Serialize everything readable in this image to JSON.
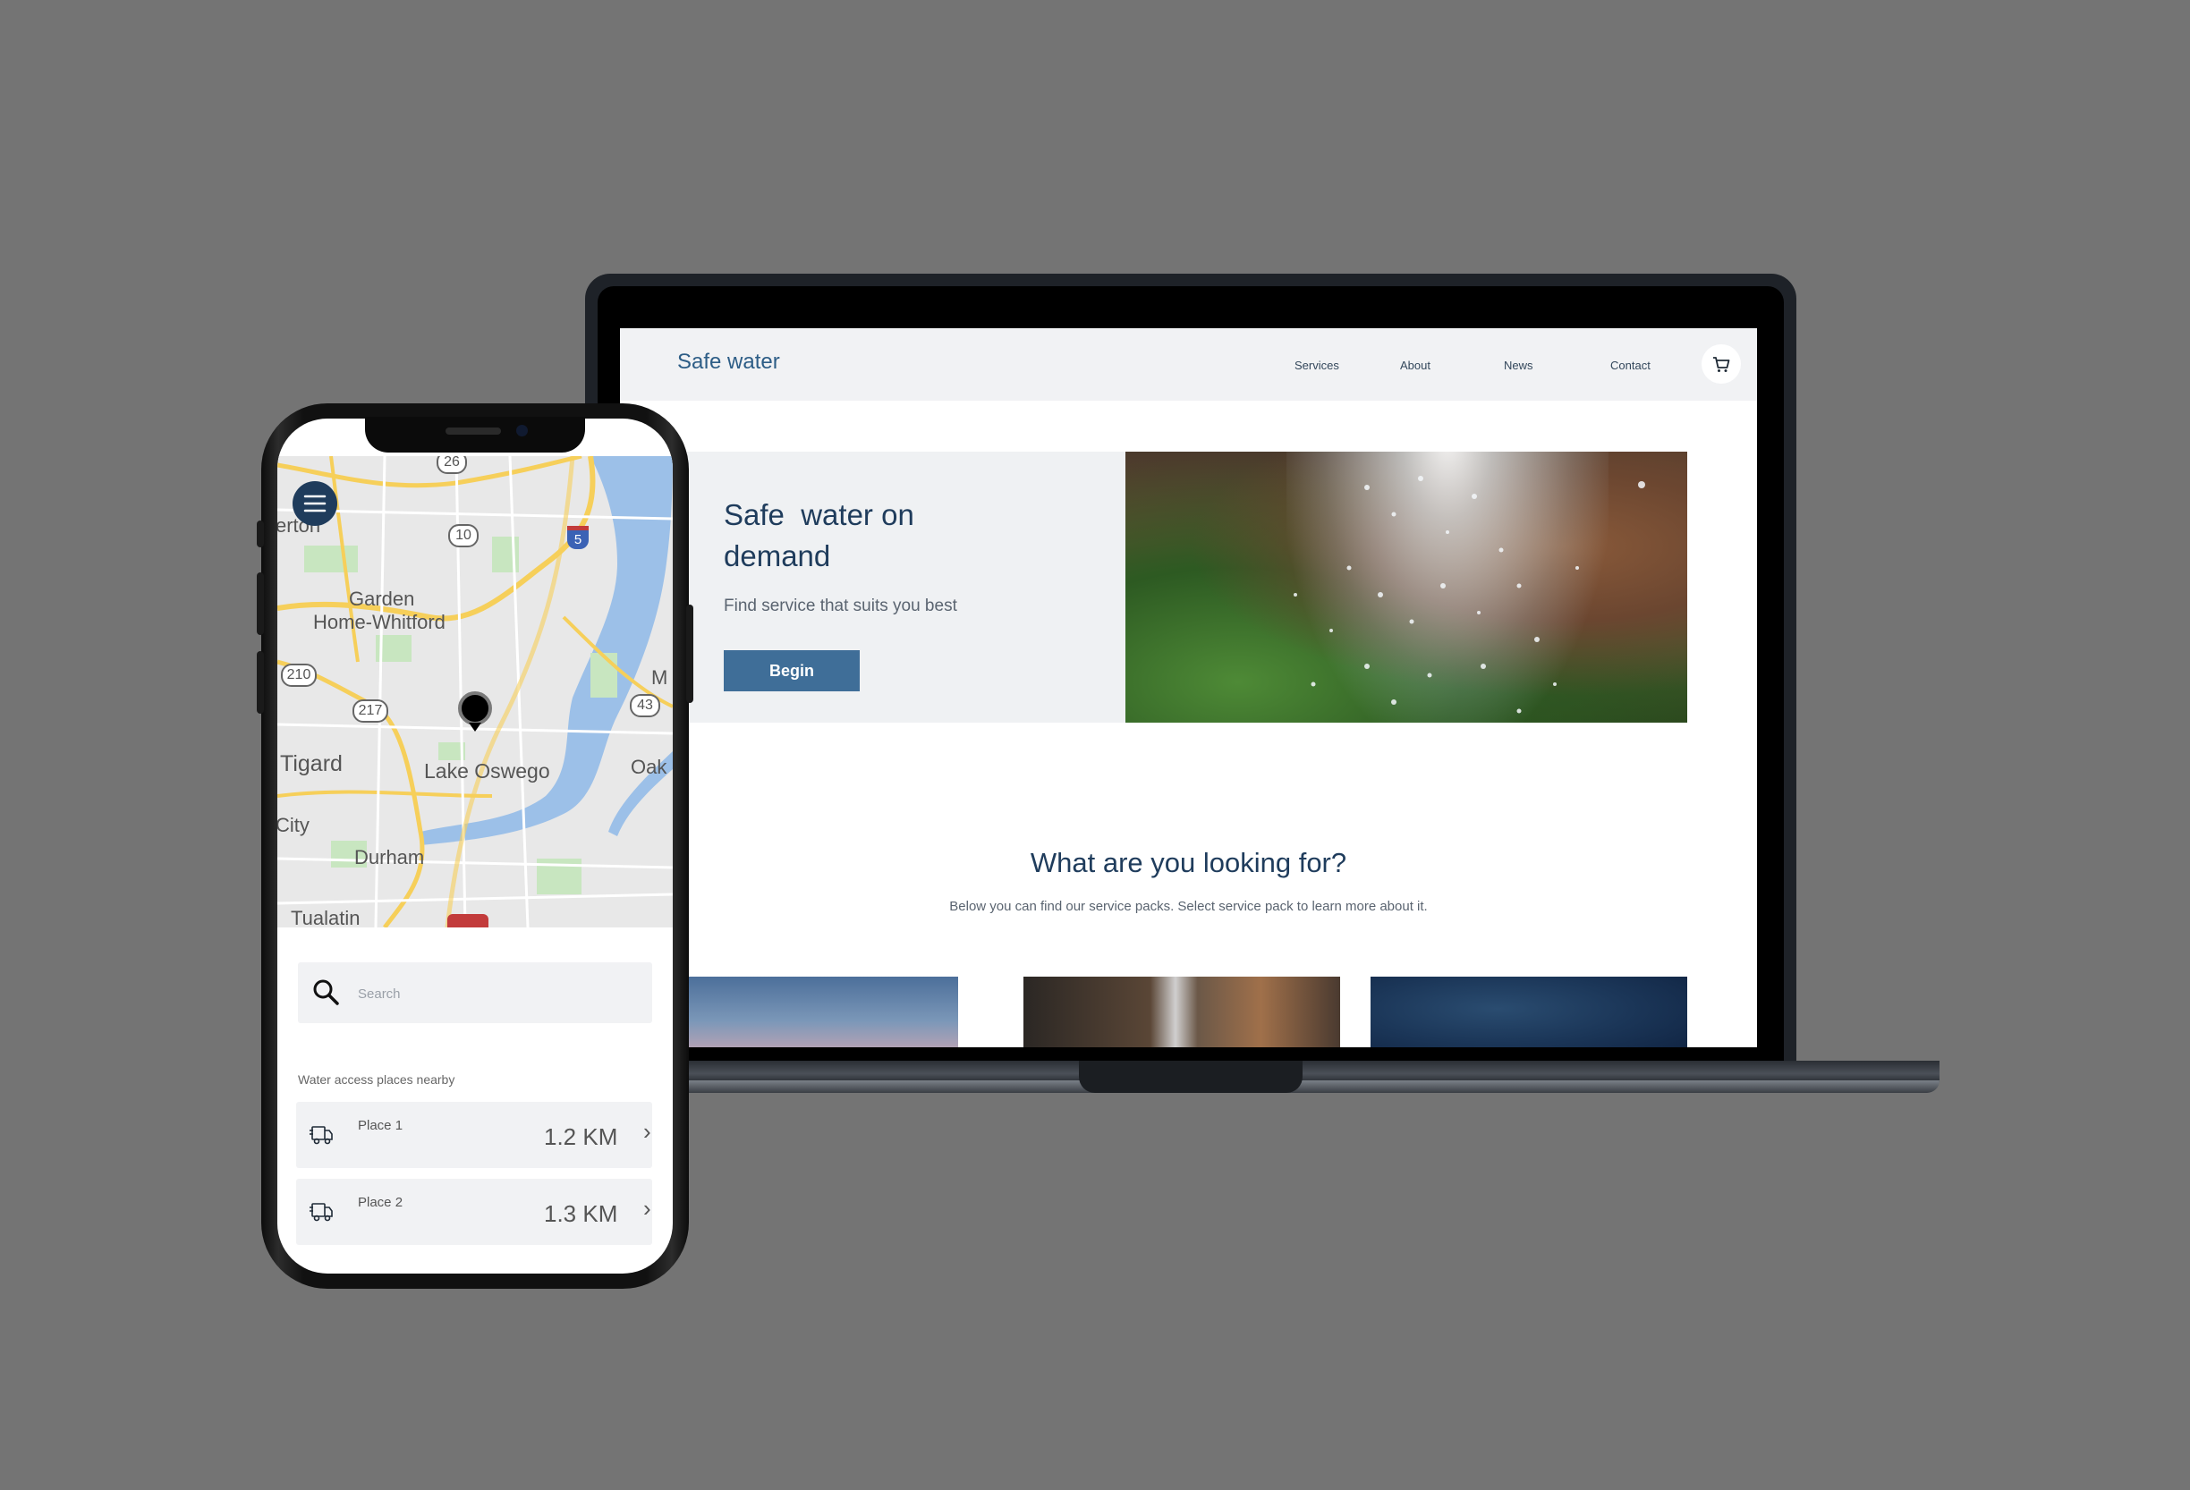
{
  "website": {
    "logo": "Safe water",
    "nav": [
      "Services",
      "About",
      "News",
      "Contact"
    ],
    "hero": {
      "title": "Safe  water on\ndemand",
      "subtitle": "Find service that suits you best",
      "button": "Begin"
    },
    "section": {
      "title": "What are you looking for?",
      "subtitle": "Below you can find our service packs. Select service pack to learn more about it."
    }
  },
  "phone": {
    "map_labels": {
      "erton": "erton",
      "garden": "Garden",
      "home_whitford": "Home-Whitford",
      "tigard": "Tigard",
      "lake_oswego": "Lake Oswego",
      "city": "City",
      "durham": "Durham",
      "tualatin": "Tualatin",
      "oak": "Oak",
      "m": "M",
      "r26": "26",
      "r10": "10",
      "r5": "5",
      "r210": "210",
      "r217": "217",
      "r43": "43"
    },
    "search": {
      "placeholder": "Search"
    },
    "nearby_label": "Water access places nearby",
    "places": [
      {
        "name": "Place 1",
        "distance": "1.2 KM"
      },
      {
        "name": "Place 2",
        "distance": "1.3 KM"
      }
    ]
  }
}
